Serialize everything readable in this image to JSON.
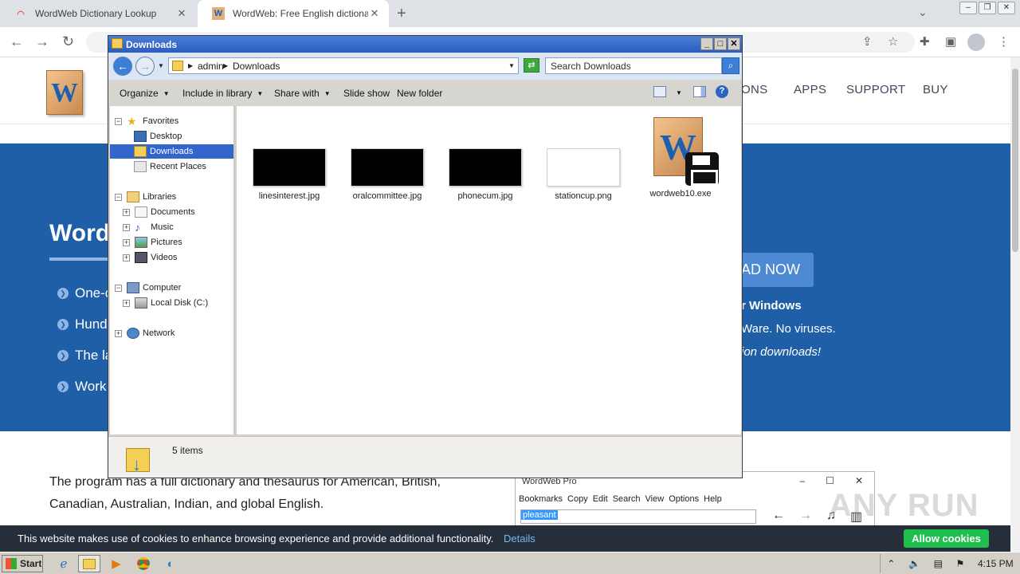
{
  "browser": {
    "tabs": [
      {
        "title": "WordWeb Dictionary Lookup",
        "close": "✕"
      },
      {
        "title": "WordWeb: Free English dictionary and",
        "close": "✕"
      }
    ],
    "new_tab": "+",
    "icons": {
      "back": "arrow-left-icon",
      "forward": "arrow-right-icon",
      "reload": "reload-icon"
    }
  },
  "site": {
    "nav": [
      "ONS",
      "APPS",
      "SUPPORT",
      "BUY"
    ],
    "hero_title": "Word",
    "bullets": [
      "One-c",
      "Hund",
      "The la",
      "Work"
    ],
    "download_button": "AD NOW",
    "hero_lines": [
      "r Windows",
      "Ware. No viruses.",
      "ion downloads!"
    ],
    "body_lines": [
      "The program has a full dictionary and thesaurus for American, British,",
      "Canadian, Australian, Indian, and global English."
    ]
  },
  "wordweb_pro": {
    "title": "WordWeb Pro",
    "menu": [
      "Bookmarks",
      "Copy",
      "Edit",
      "Search",
      "View",
      "Options",
      "Help"
    ],
    "search_value": "pleasant"
  },
  "cookie_bar": {
    "message": "This website makes use of cookies to enhance browsing experience and provide additional functionality.",
    "details": "Details",
    "allow": "Allow cookies"
  },
  "watermark": "ANY RUN",
  "explorer": {
    "title": "Downloads",
    "address": [
      "admin",
      "Downloads"
    ],
    "search_placeholder": "Search Downloads",
    "commands": [
      "Organize",
      "Include in library",
      "Share with",
      "Slide show",
      "New folder"
    ],
    "tree": {
      "favorites": "Favorites",
      "desktop": "Desktop",
      "downloads": "Downloads",
      "recent": "Recent Places",
      "libraries": "Libraries",
      "documents": "Documents",
      "music": "Music",
      "pictures": "Pictures",
      "videos": "Videos",
      "computer": "Computer",
      "local_disk": "Local Disk (C:)",
      "network": "Network"
    },
    "files": [
      {
        "name": "linesinterest.jpg",
        "thumb": "#000000"
      },
      {
        "name": "oralcommittee.jpg",
        "thumb": "#000000"
      },
      {
        "name": "phonecum.jpg",
        "thumb": "#000000"
      },
      {
        "name": "stationcup.png",
        "thumb": "#ffffff"
      },
      {
        "name": "wordweb10.exe",
        "thumb": "wordweb-installer-icon"
      }
    ],
    "status": "5 items"
  },
  "taskbar": {
    "start": "Start",
    "clock": "4:15 PM"
  }
}
